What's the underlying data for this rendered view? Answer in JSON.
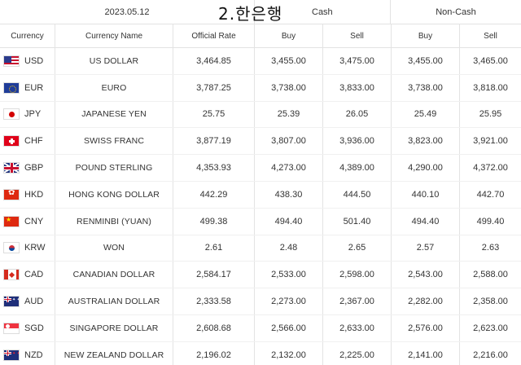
{
  "overlay_title": "2.한은행",
  "top_header": {
    "date": "2023.05.12",
    "cash": "Cash",
    "non_cash": "Non-Cash"
  },
  "columns": [
    "Currency",
    "Currency Name",
    "Official Rate",
    "Buy",
    "Sell",
    "Buy",
    "Sell"
  ],
  "rows": [
    {
      "flag": "usd",
      "code": "USD",
      "name": "US DOLLAR",
      "official": "3,464.85",
      "cash_buy": "3,455.00",
      "cash_sell": "3,475.00",
      "noncash_buy": "3,455.00",
      "noncash_sell": "3,465.00"
    },
    {
      "flag": "eur",
      "code": "EUR",
      "name": "EURO",
      "official": "3,787.25",
      "cash_buy": "3,738.00",
      "cash_sell": "3,833.00",
      "noncash_buy": "3,738.00",
      "noncash_sell": "3,818.00"
    },
    {
      "flag": "jpy",
      "code": "JPY",
      "name": "JAPANESE YEN",
      "official": "25.75",
      "cash_buy": "25.39",
      "cash_sell": "26.05",
      "noncash_buy": "25.49",
      "noncash_sell": "25.95"
    },
    {
      "flag": "chf",
      "code": "CHF",
      "name": "SWISS FRANC",
      "official": "3,877.19",
      "cash_buy": "3,807.00",
      "cash_sell": "3,936.00",
      "noncash_buy": "3,823.00",
      "noncash_sell": "3,921.00"
    },
    {
      "flag": "gbp",
      "code": "GBP",
      "name": "POUND STERLING",
      "official": "4,353.93",
      "cash_buy": "4,273.00",
      "cash_sell": "4,389.00",
      "noncash_buy": "4,290.00",
      "noncash_sell": "4,372.00"
    },
    {
      "flag": "hkd",
      "code": "HKD",
      "name": "HONG KONG DOLLAR",
      "official": "442.29",
      "cash_buy": "438.30",
      "cash_sell": "444.50",
      "noncash_buy": "440.10",
      "noncash_sell": "442.70"
    },
    {
      "flag": "cny",
      "code": "CNY",
      "name": "RENMINBI (YUAN)",
      "official": "499.38",
      "cash_buy": "494.40",
      "cash_sell": "501.40",
      "noncash_buy": "494.40",
      "noncash_sell": "499.40"
    },
    {
      "flag": "krw",
      "code": "KRW",
      "name": "WON",
      "official": "2.61",
      "cash_buy": "2.48",
      "cash_sell": "2.65",
      "noncash_buy": "2.57",
      "noncash_sell": "2.63"
    },
    {
      "flag": "cad",
      "code": "CAD",
      "name": "CANADIAN DOLLAR",
      "official": "2,584.17",
      "cash_buy": "2,533.00",
      "cash_sell": "2,598.00",
      "noncash_buy": "2,543.00",
      "noncash_sell": "2,588.00"
    },
    {
      "flag": "aud",
      "code": "AUD",
      "name": "AUSTRALIAN DOLLAR",
      "official": "2,333.58",
      "cash_buy": "2,273.00",
      "cash_sell": "2,367.00",
      "noncash_buy": "2,282.00",
      "noncash_sell": "2,358.00"
    },
    {
      "flag": "sgd",
      "code": "SGD",
      "name": "SINGAPORE DOLLAR",
      "official": "2,608.68",
      "cash_buy": "2,566.00",
      "cash_sell": "2,633.00",
      "noncash_buy": "2,576.00",
      "noncash_sell": "2,623.00"
    },
    {
      "flag": "nzd",
      "code": "NZD",
      "name": "NEW ZEALAND DOLLAR",
      "official": "2,196.02",
      "cash_buy": "2,132.00",
      "cash_sell": "2,225.00",
      "noncash_buy": "2,141.00",
      "noncash_sell": "2,216.00"
    }
  ]
}
